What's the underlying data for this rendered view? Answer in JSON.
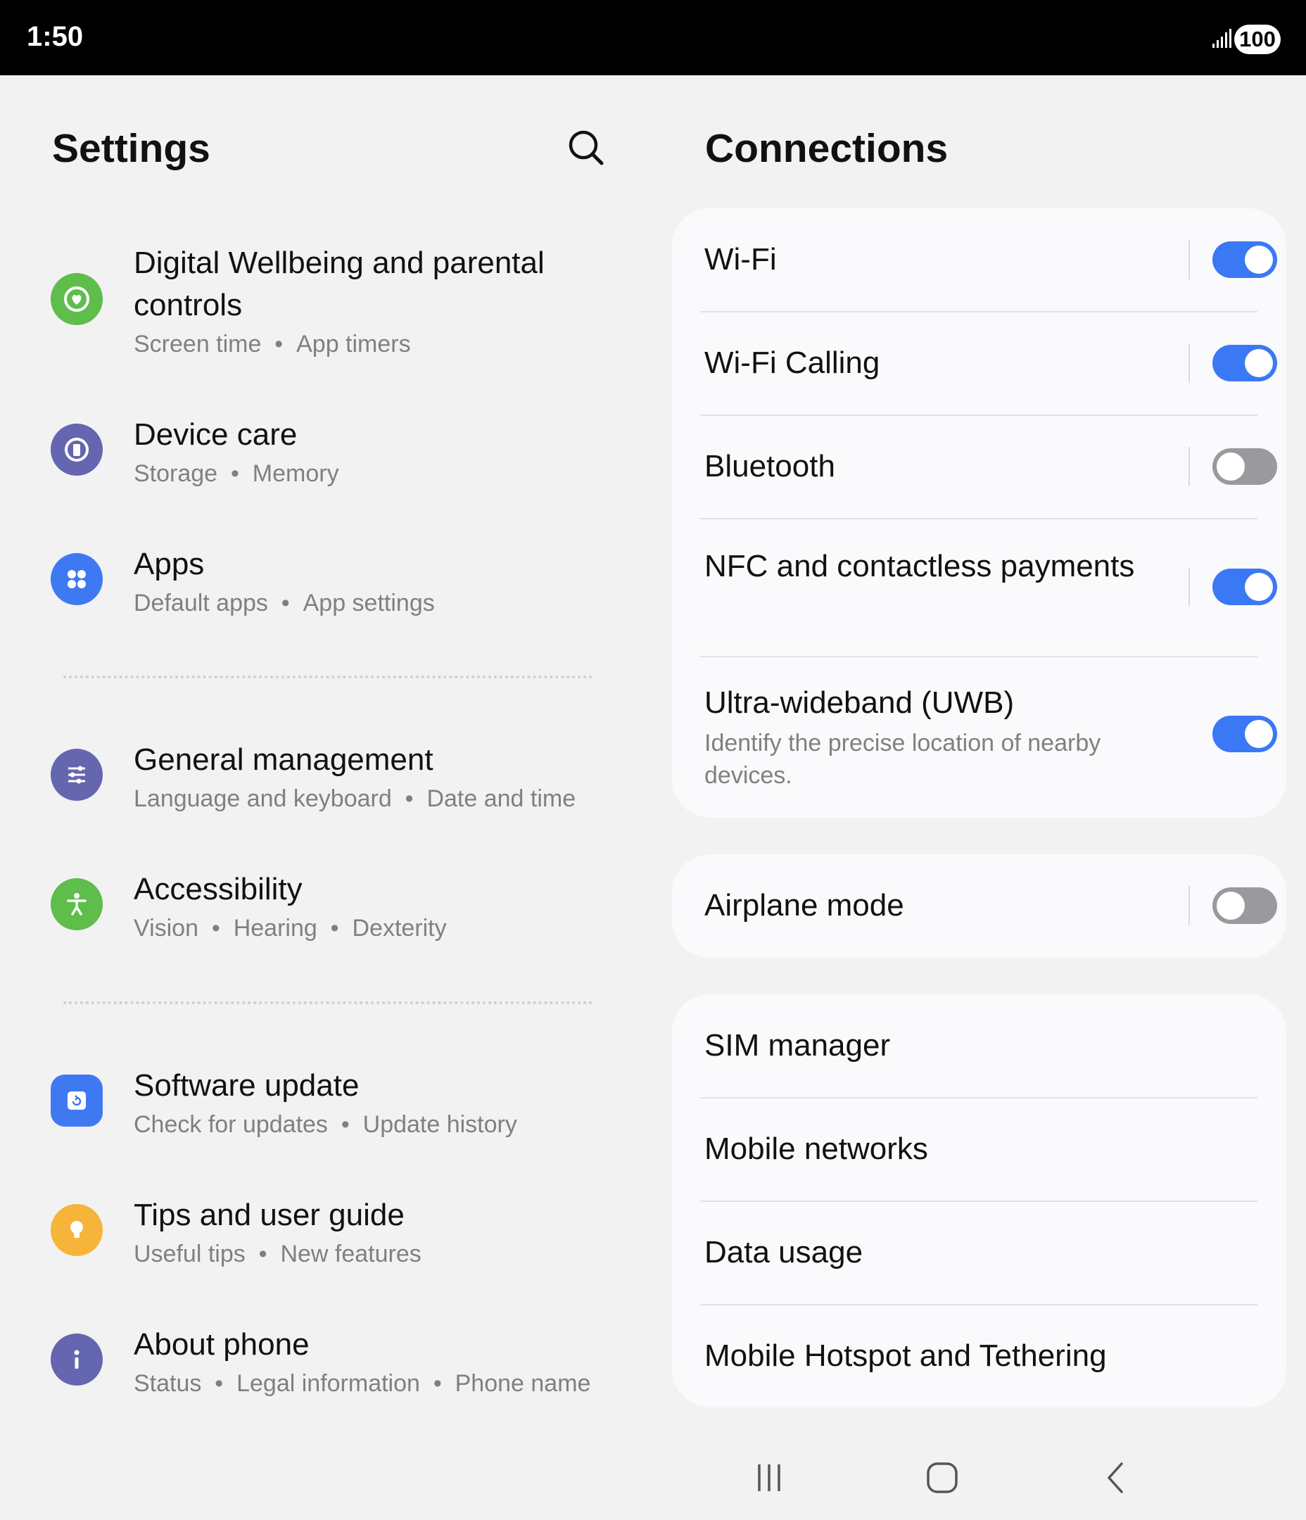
{
  "status_bar": {
    "time": "1:50",
    "battery": "100"
  },
  "settings": {
    "title": "Settings",
    "items": [
      {
        "title": "Digital Wellbeing and parental controls",
        "subtitle": [
          "Screen time",
          "App timers"
        ],
        "icon": "digital-wellbeing-icon",
        "color": "#5fbd4b"
      },
      {
        "title": "Device care",
        "subtitle": [
          "Storage",
          "Memory"
        ],
        "icon": "device-care-icon",
        "color": "#6466b0"
      },
      {
        "title": "Apps",
        "subtitle": [
          "Default apps",
          "App settings"
        ],
        "icon": "apps-icon",
        "color": "#3f79f2"
      },
      {
        "title": "General management",
        "subtitle": [
          "Language and keyboard",
          "Date and time"
        ],
        "icon": "general-management-icon",
        "color": "#6466b0"
      },
      {
        "title": "Accessibility",
        "subtitle": [
          "Vision",
          "Hearing",
          "Dexterity"
        ],
        "icon": "accessibility-icon",
        "color": "#5fbd4b"
      },
      {
        "title": "Software update",
        "subtitle": [
          "Check for updates",
          "Update history"
        ],
        "icon": "software-update-icon",
        "color": "#3f79f2"
      },
      {
        "title": "Tips and user guide",
        "subtitle": [
          "Useful tips",
          "New features"
        ],
        "icon": "lightbulb-icon",
        "color": "#f7b43a"
      },
      {
        "title": "About phone",
        "subtitle": [
          "Status",
          "Legal information",
          "Phone name"
        ],
        "icon": "info-icon",
        "color": "#6466b0"
      }
    ]
  },
  "connections": {
    "title": "Connections",
    "group1": [
      {
        "label": "Wi-Fi",
        "toggle": true
      },
      {
        "label": "Wi-Fi Calling",
        "toggle": true
      },
      {
        "label": "Bluetooth",
        "toggle": false
      },
      {
        "label": "NFC and contactless payments",
        "toggle": true
      },
      {
        "label": "Ultra-wideband (UWB)",
        "description": "Identify the precise location of nearby devices.",
        "toggle": true
      }
    ],
    "group2": [
      {
        "label": "Airplane mode",
        "toggle": false
      }
    ],
    "group3": [
      {
        "label": "SIM manager"
      },
      {
        "label": "Mobile networks"
      },
      {
        "label": "Data usage"
      },
      {
        "label": "Mobile Hotspot and Tethering"
      }
    ]
  },
  "colors": {
    "toggle_on": "#3b78f5",
    "toggle_off": "#9a9a9e"
  }
}
